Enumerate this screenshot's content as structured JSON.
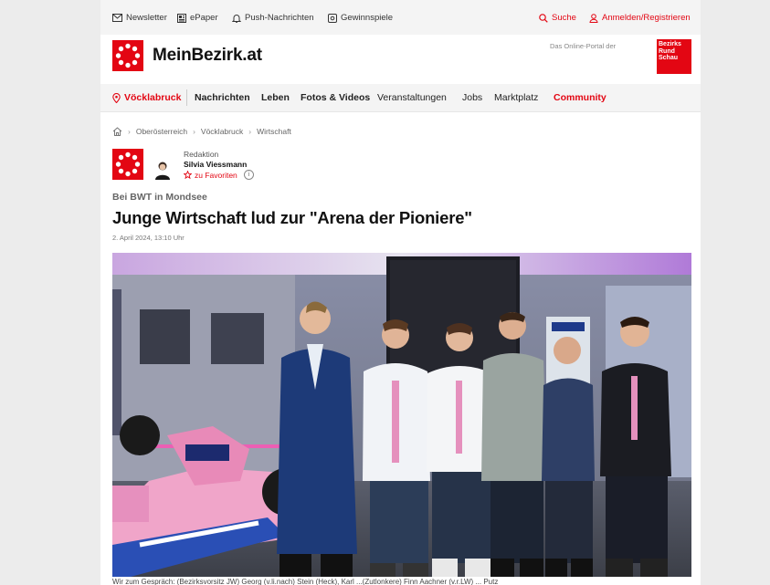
{
  "topbar": {
    "newsletter": "Newsletter",
    "epaper": "ePaper",
    "push": "Push-Nachrichten",
    "gewinnspiele": "Gewinnspiele",
    "search": "Suche",
    "login": "Anmelden/Registrieren"
  },
  "header": {
    "brand": "MeinBezirk.at",
    "portal_text": "Das Online-Portal der",
    "partner_lines": [
      "Bezirks",
      "Rund",
      "Schau"
    ]
  },
  "nav": {
    "location": "Vöcklabruck",
    "items": [
      "Nachrichten",
      "Leben",
      "Fotos & Videos",
      "Veranstaltungen",
      "Jobs",
      "Marktplatz",
      "Community"
    ]
  },
  "breadcrumb": [
    "Oberösterreich",
    "Vöcklabruck",
    "Wirtschaft"
  ],
  "author": {
    "role": "Redaktion",
    "name": "Silvia Viessmann",
    "favorite": "zu Favoriten"
  },
  "article": {
    "kicker": "Bei BWT in Mondsee",
    "title": "Junge Wirtschaft lud zur \"Arena der Pioniere\"",
    "date": "2. April 2024, 13:10 Uhr",
    "caption": "Wir zum Gespräch: (Bezirksvorsitz JW) Georg (v.li.nach) Stein (Heck), Karl ...(Zutlonkere) Finn Aachner (v.r.LW) ... Putz"
  },
  "colors": {
    "accent": "#e30613",
    "topbar_bg": "#f4f4f4"
  },
  "icons": [
    "envelope-icon",
    "newspaper-icon",
    "bell-icon",
    "gift-icon",
    "search-icon",
    "user-icon",
    "pin-icon",
    "home-icon",
    "star-icon",
    "info-icon"
  ]
}
